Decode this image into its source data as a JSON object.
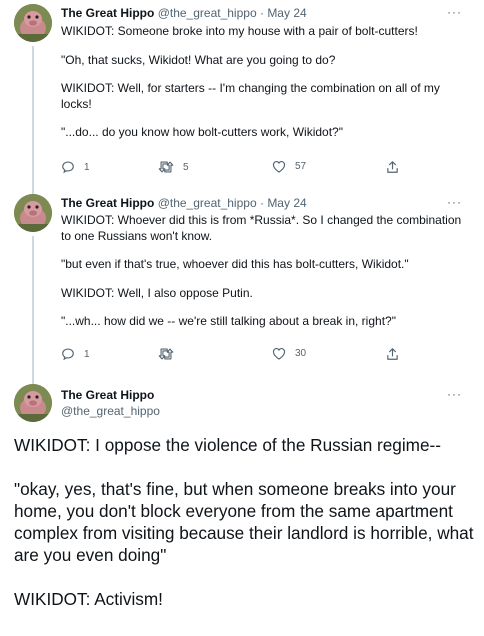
{
  "tweets": [
    {
      "name": "The Great Hippo",
      "handle": "@the_great_hippo",
      "date": "May 24",
      "paragraphs": [
        "WIKIDOT: Someone broke into my house with a pair of bolt-cutters!",
        "\"Oh, that sucks, Wikidot! What are you going to do?",
        "WIKIDOT: Well, for starters -- I'm changing the combination on all of my locks!",
        "\"...do... do you know how bolt-cutters work, Wikidot?\""
      ],
      "replies": "1",
      "retweets": "5",
      "likes": "57"
    },
    {
      "name": "The Great Hippo",
      "handle": "@the_great_hippo",
      "date": "May 24",
      "paragraphs": [
        "WIKIDOT: Whoever did this is from *Russia*. So I changed the combination to one Russians won't know.",
        "\"but even if that's true, whoever did this has bolt-cutters, Wikidot.\"",
        "WIKIDOT: Well, I also oppose Putin.",
        "\"...wh... how did we -- we're still talking about a break in, right?\""
      ],
      "replies": "1",
      "retweets": "",
      "likes": "30"
    }
  ],
  "main_tweet": {
    "name": "The Great Hippo",
    "handle": "@the_great_hippo",
    "paragraphs": [
      "WIKIDOT: I oppose the violence of the Russian regime--",
      "\"okay, yes, that's fine, but when someone breaks into your home, you don't block everyone from the same apartment complex from visiting because their landlord is horrible, what are you even doing\"",
      "WIKIDOT: Activism!"
    ]
  },
  "icons": {
    "reply": "reply-icon",
    "retweet": "retweet-icon",
    "like": "heart-icon",
    "share": "share-icon",
    "more": "more-options-icon"
  },
  "more_label": "···",
  "colors": {
    "text": "#0f1419",
    "secondary": "#536471",
    "thread_line": "#cfd9de",
    "background": "#ffffff"
  }
}
